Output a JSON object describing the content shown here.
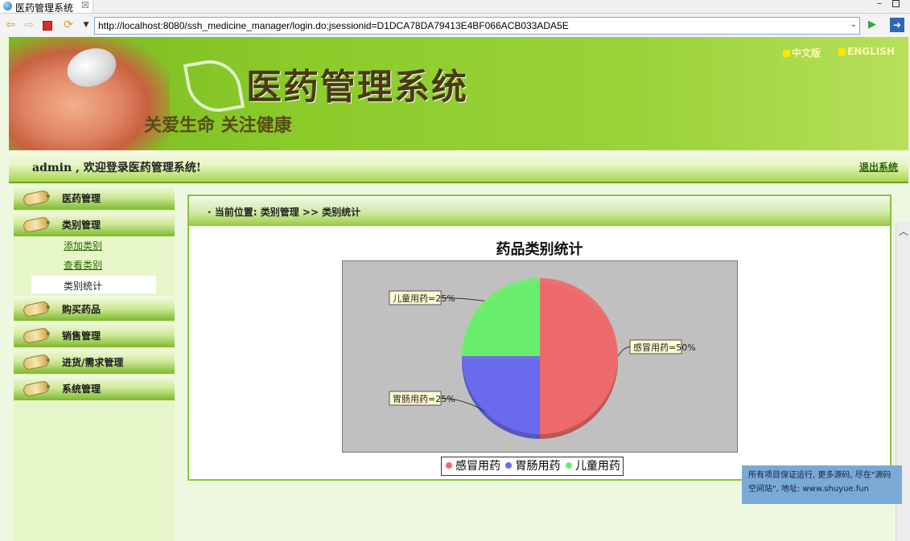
{
  "browser": {
    "tab_title": "医药管理系统",
    "tab_close": "☒",
    "url": "http://localhost:8080/ssh_medicine_manager/login.do;jsessionid=D1DCA78DA79413E4BF066ACB033ADA5E",
    "icons": [
      "back-arrow-icon",
      "forward-arrow-icon",
      "stop-icon",
      "refresh-icon",
      "go-icon",
      "external-icon"
    ]
  },
  "header": {
    "title": "医药管理系统",
    "slogan": "关爱生命  关注健康",
    "lang_zh": "中文版",
    "lang_en": "ENGLISH"
  },
  "welcome": {
    "text": "admin , 欢迎登录医药管理系统!",
    "logout": "退出系统"
  },
  "sidebar": {
    "items": [
      {
        "label": "医药管理"
      },
      {
        "label": "类别管理"
      },
      {
        "label": "购买药品"
      },
      {
        "label": "销售管理"
      },
      {
        "label": "进货/需求管理"
      },
      {
        "label": "系统管理"
      }
    ],
    "submenu": [
      {
        "label": "添加类别"
      },
      {
        "label": "查看类别"
      },
      {
        "label": "类别统计"
      }
    ]
  },
  "content": {
    "breadcrumb": "· 当前位置:  类别管理 >> 类别统计"
  },
  "chart_data": {
    "type": "pie",
    "title": "药品类别统计",
    "categories": [
      "感冒用药",
      "胃肠用药",
      "儿童用药"
    ],
    "values": [
      50,
      25,
      25
    ],
    "labels": [
      "感冒用药=50%",
      "胃肠用药=25%",
      "儿童用药=25%"
    ],
    "colors": [
      "#ef6b6b",
      "#6b6bef",
      "#6bef6b"
    ],
    "legend_position": "bottom",
    "plot_background": "#c0c0c0"
  },
  "watermark": {
    "line1": "所有项目保证运行, 更多源码, 尽在\"源码",
    "line2": "空间站\", 地址: www.shuyue.fun"
  }
}
